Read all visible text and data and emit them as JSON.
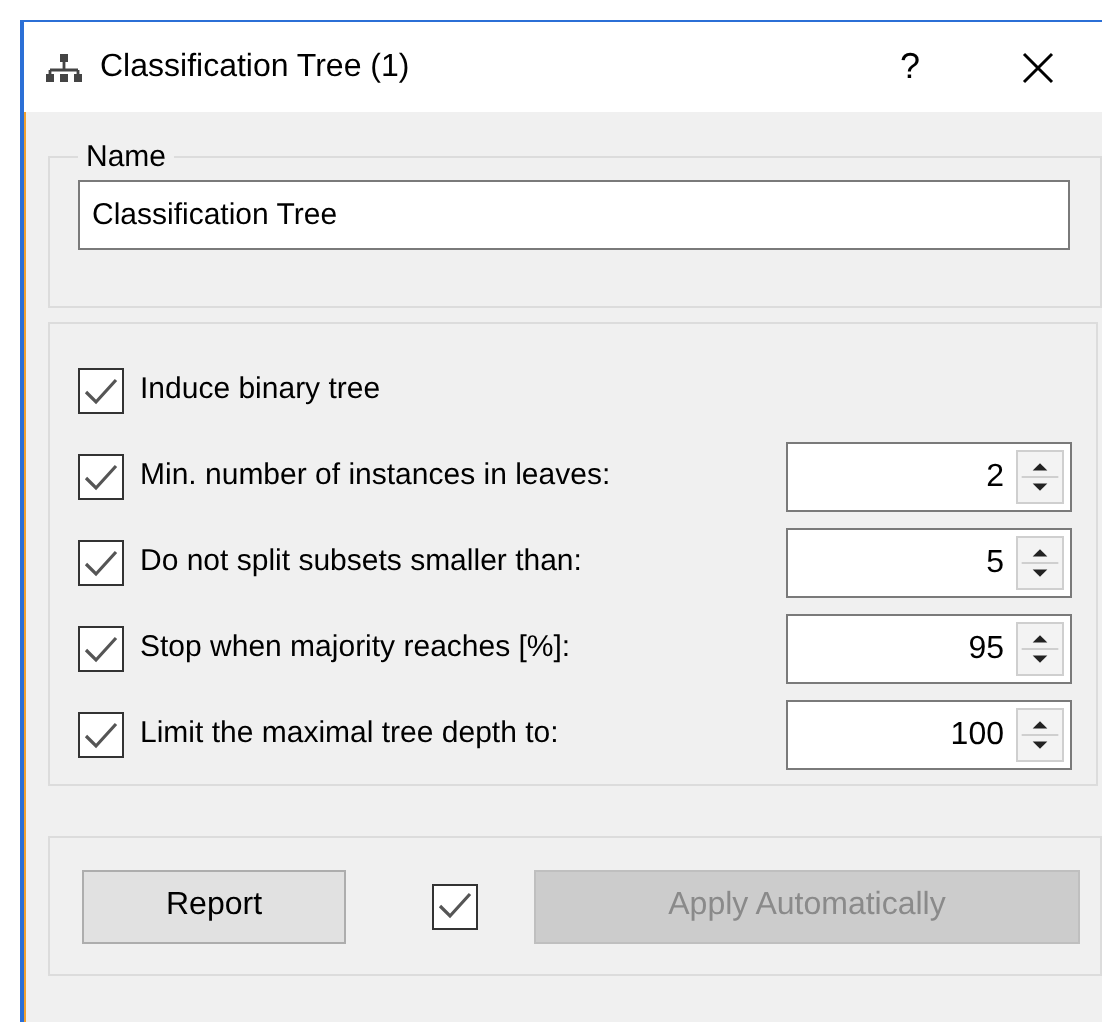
{
  "window": {
    "title": "Classification Tree (1)",
    "help": "?"
  },
  "name_group": {
    "legend": "Name",
    "value": "Classification Tree"
  },
  "options": [
    {
      "kind": "check",
      "label": "Induce binary tree",
      "checked": true
    },
    {
      "kind": "spin",
      "label": "Min. number of instances in leaves:",
      "checked": true,
      "value": "2"
    },
    {
      "kind": "spin",
      "label": "Do not split subsets smaller than:",
      "checked": true,
      "value": "5"
    },
    {
      "kind": "spin",
      "label": "Stop when majority reaches [%]:",
      "checked": true,
      "value": "95"
    },
    {
      "kind": "spin",
      "label": "Limit the maximal tree depth to:",
      "checked": true,
      "value": "100"
    }
  ],
  "footer": {
    "report": "Report",
    "auto_apply_checked": true,
    "apply": {
      "label": "Apply Automatically",
      "disabled": true
    }
  }
}
